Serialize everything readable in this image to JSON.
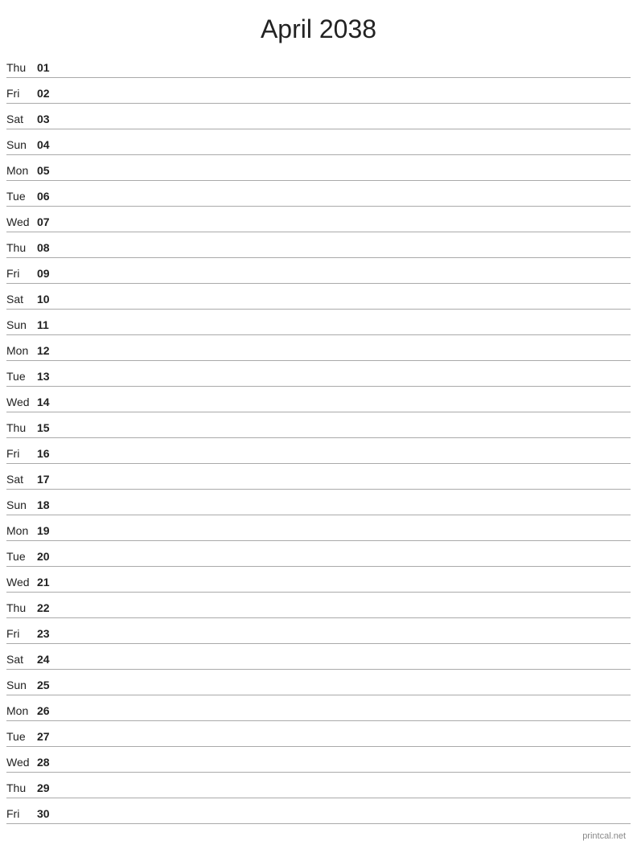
{
  "header": {
    "title": "April 2038"
  },
  "days": [
    {
      "name": "Thu",
      "num": "01"
    },
    {
      "name": "Fri",
      "num": "02"
    },
    {
      "name": "Sat",
      "num": "03"
    },
    {
      "name": "Sun",
      "num": "04"
    },
    {
      "name": "Mon",
      "num": "05"
    },
    {
      "name": "Tue",
      "num": "06"
    },
    {
      "name": "Wed",
      "num": "07"
    },
    {
      "name": "Thu",
      "num": "08"
    },
    {
      "name": "Fri",
      "num": "09"
    },
    {
      "name": "Sat",
      "num": "10"
    },
    {
      "name": "Sun",
      "num": "11"
    },
    {
      "name": "Mon",
      "num": "12"
    },
    {
      "name": "Tue",
      "num": "13"
    },
    {
      "name": "Wed",
      "num": "14"
    },
    {
      "name": "Thu",
      "num": "15"
    },
    {
      "name": "Fri",
      "num": "16"
    },
    {
      "name": "Sat",
      "num": "17"
    },
    {
      "name": "Sun",
      "num": "18"
    },
    {
      "name": "Mon",
      "num": "19"
    },
    {
      "name": "Tue",
      "num": "20"
    },
    {
      "name": "Wed",
      "num": "21"
    },
    {
      "name": "Thu",
      "num": "22"
    },
    {
      "name": "Fri",
      "num": "23"
    },
    {
      "name": "Sat",
      "num": "24"
    },
    {
      "name": "Sun",
      "num": "25"
    },
    {
      "name": "Mon",
      "num": "26"
    },
    {
      "name": "Tue",
      "num": "27"
    },
    {
      "name": "Wed",
      "num": "28"
    },
    {
      "name": "Thu",
      "num": "29"
    },
    {
      "name": "Fri",
      "num": "30"
    }
  ],
  "footer": {
    "text": "printcal.net"
  }
}
